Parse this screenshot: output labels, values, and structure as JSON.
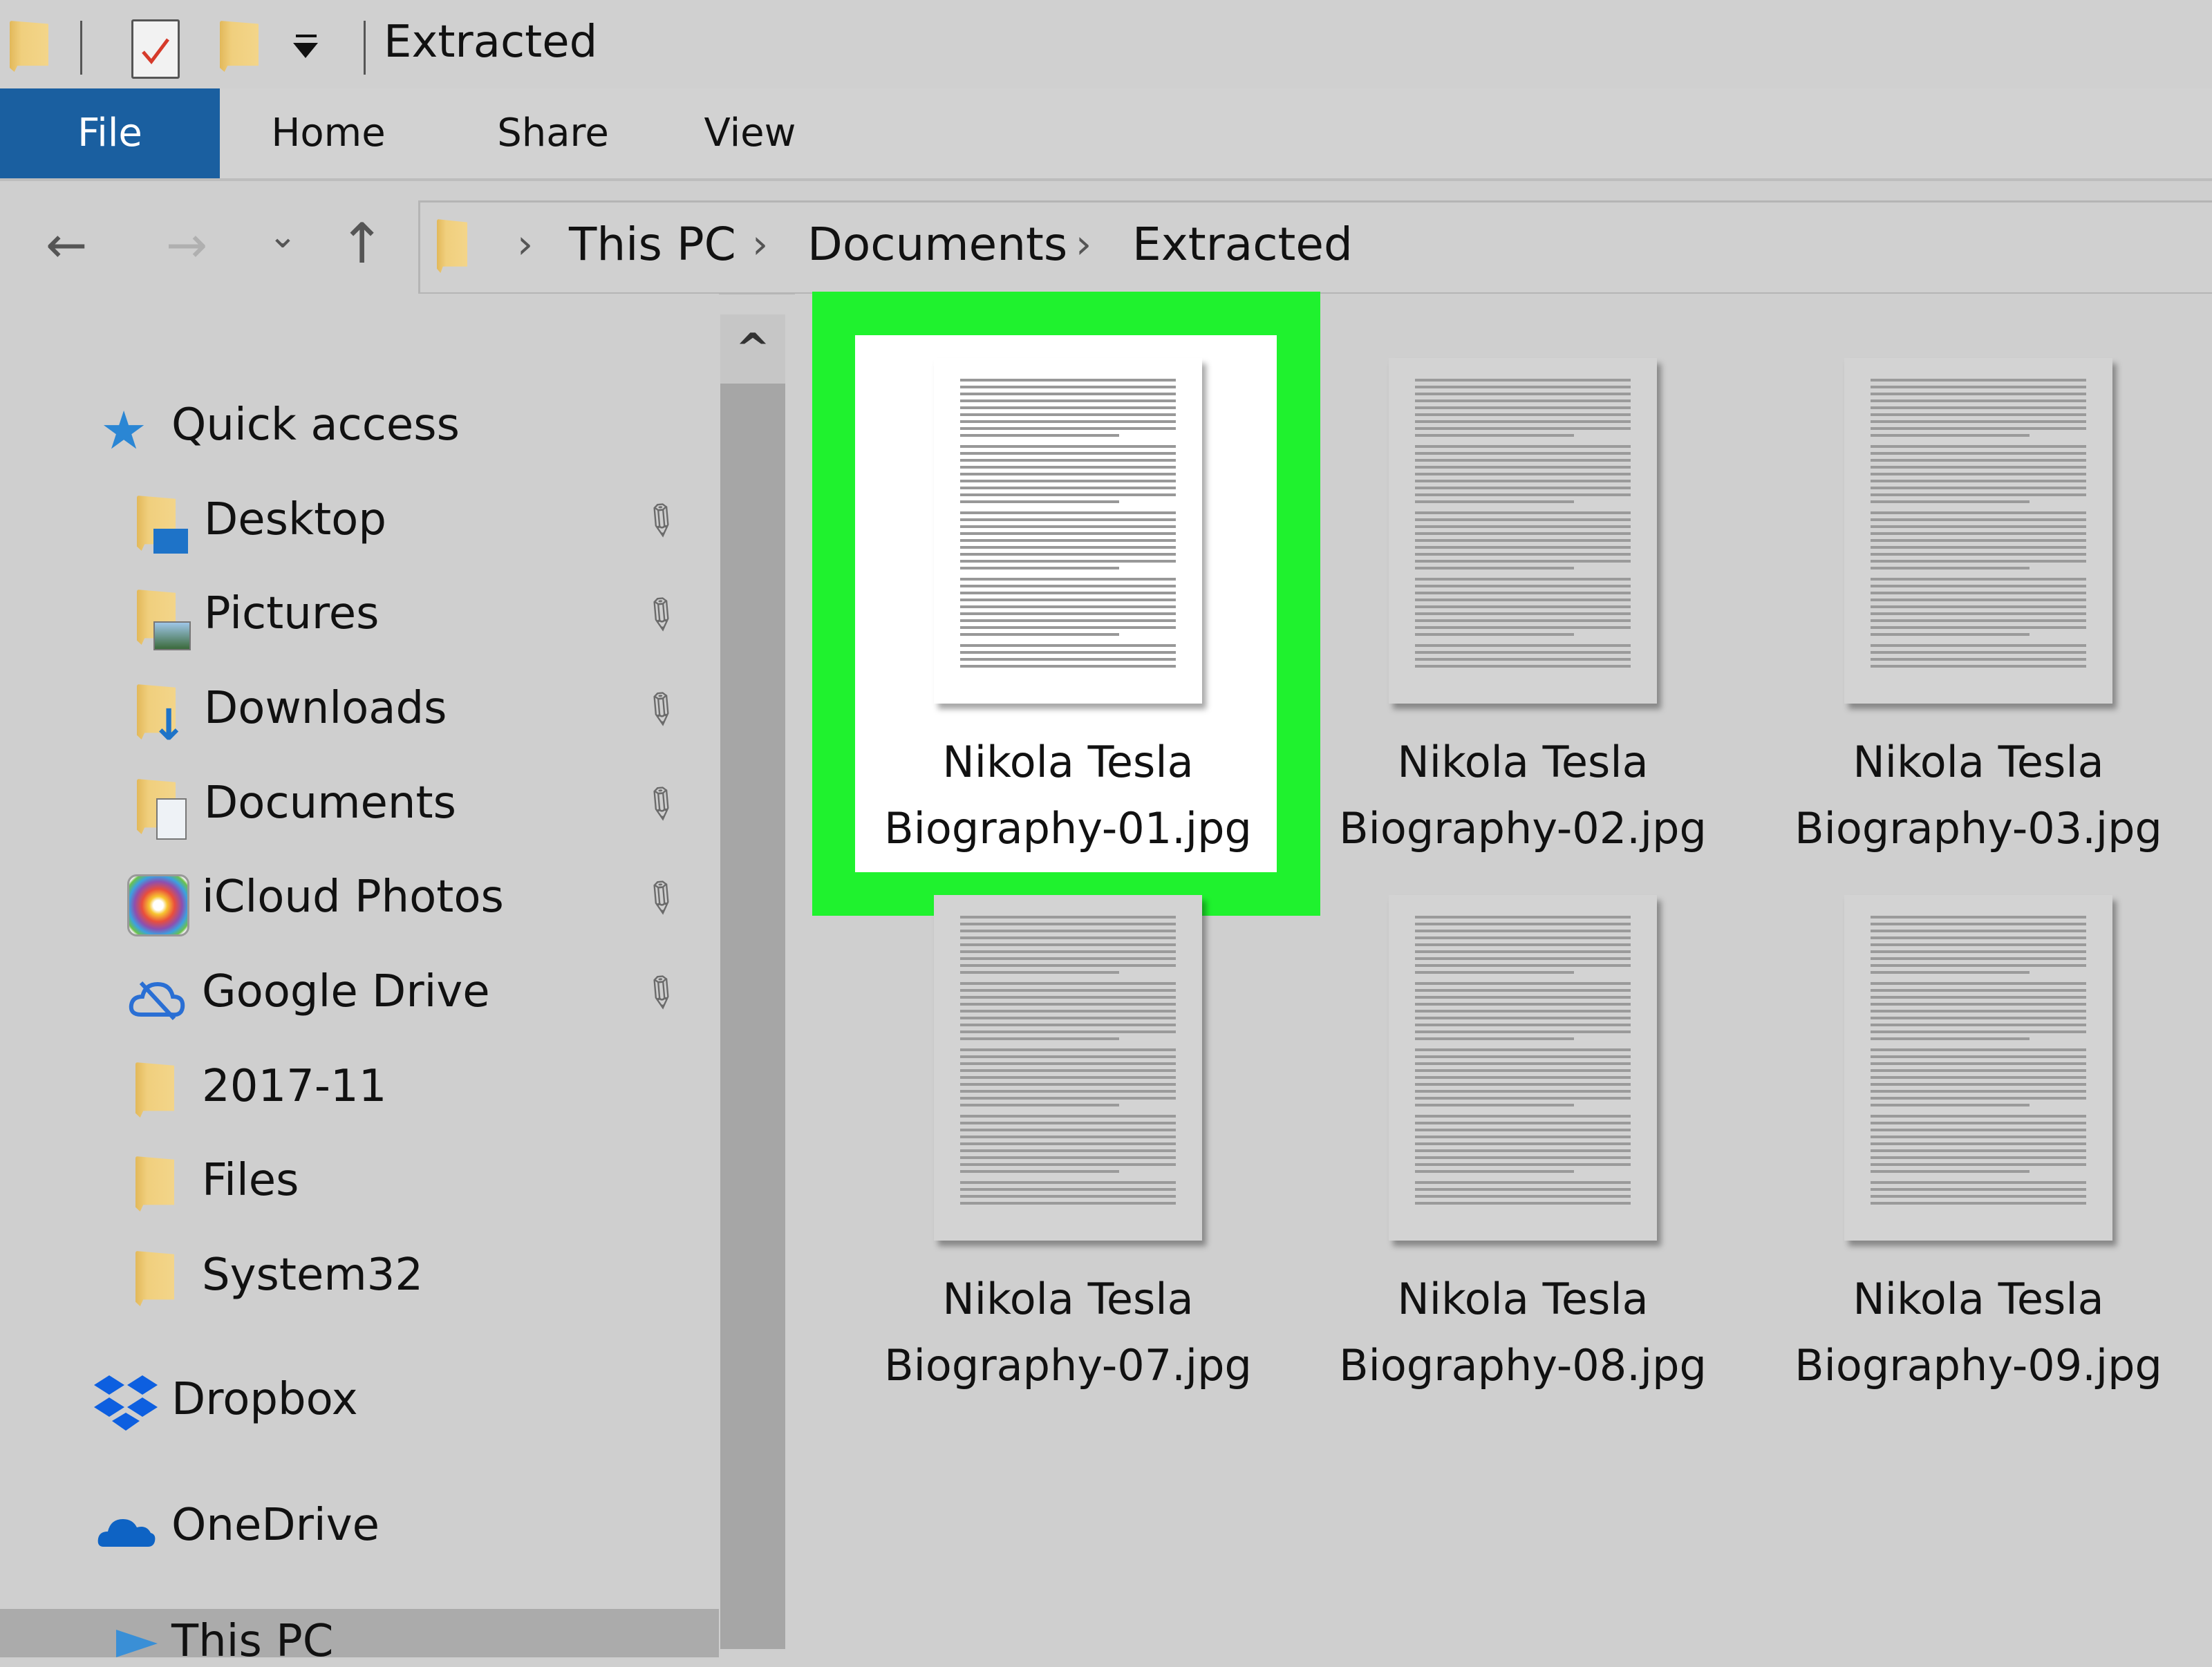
{
  "window": {
    "title": "Extracted",
    "quick_access_toolbar": [
      "folder-icon",
      "properties-icon",
      "new-folder-icon",
      "customize-dropdown-icon"
    ]
  },
  "ribbon": {
    "tabs": [
      {
        "label": "File",
        "active": true
      },
      {
        "label": "Home"
      },
      {
        "label": "Share"
      },
      {
        "label": "View"
      }
    ]
  },
  "navigation": {
    "back": "←",
    "forward": "→",
    "recent": "⌄",
    "up": "↑",
    "breadcrumb": [
      "This PC",
      "Documents",
      "Extracted"
    ],
    "separator": "›"
  },
  "sidebar": {
    "quick_access": {
      "label": "Quick access",
      "icon": "star-icon"
    },
    "items": [
      {
        "label": "Desktop",
        "icon": "desktop-folder-icon",
        "pinned": true
      },
      {
        "label": "Pictures",
        "icon": "pictures-folder-icon",
        "pinned": true
      },
      {
        "label": "Downloads",
        "icon": "downloads-folder-icon",
        "pinned": true
      },
      {
        "label": "Documents",
        "icon": "documents-folder-icon",
        "pinned": true
      },
      {
        "label": "iCloud Photos",
        "icon": "icloud-photos-icon",
        "pinned": true
      },
      {
        "label": "Google Drive",
        "icon": "google-drive-icon",
        "pinned": true
      },
      {
        "label": "2017-11",
        "icon": "folder-icon",
        "pinned": false
      },
      {
        "label": "Files",
        "icon": "folder-icon",
        "pinned": false
      },
      {
        "label": "System32",
        "icon": "folder-icon",
        "pinned": false
      }
    ],
    "roots": [
      {
        "label": "Dropbox",
        "icon": "dropbox-icon"
      },
      {
        "label": "OneDrive",
        "icon": "onedrive-icon"
      },
      {
        "label": "This PC",
        "icon": "this-pc-icon"
      }
    ],
    "pin_glyph": "📌"
  },
  "scrollbar": {
    "up_glyph": "^"
  },
  "files": [
    {
      "line1": "Nikola Tesla",
      "line2": "Biography-01.jpg",
      "selected": true
    },
    {
      "line1": "Nikola Tesla",
      "line2": "Biography-02.jpg",
      "selected": false
    },
    {
      "line1": "Nikola Tesla",
      "line2": "Biography-03.jpg",
      "selected": false
    },
    {
      "line1": "Nikola Tesla",
      "line2": "Biography-07.jpg",
      "selected": false
    },
    {
      "line1": "Nikola Tesla",
      "line2": "Biography-08.jpg",
      "selected": false
    },
    {
      "line1": "Nikola Tesla",
      "line2": "Biography-09.jpg",
      "selected": false
    }
  ],
  "colors": {
    "highlight": "#1ff22e",
    "file_tab": "#1a5fa0",
    "background": "#cfcfcf"
  }
}
